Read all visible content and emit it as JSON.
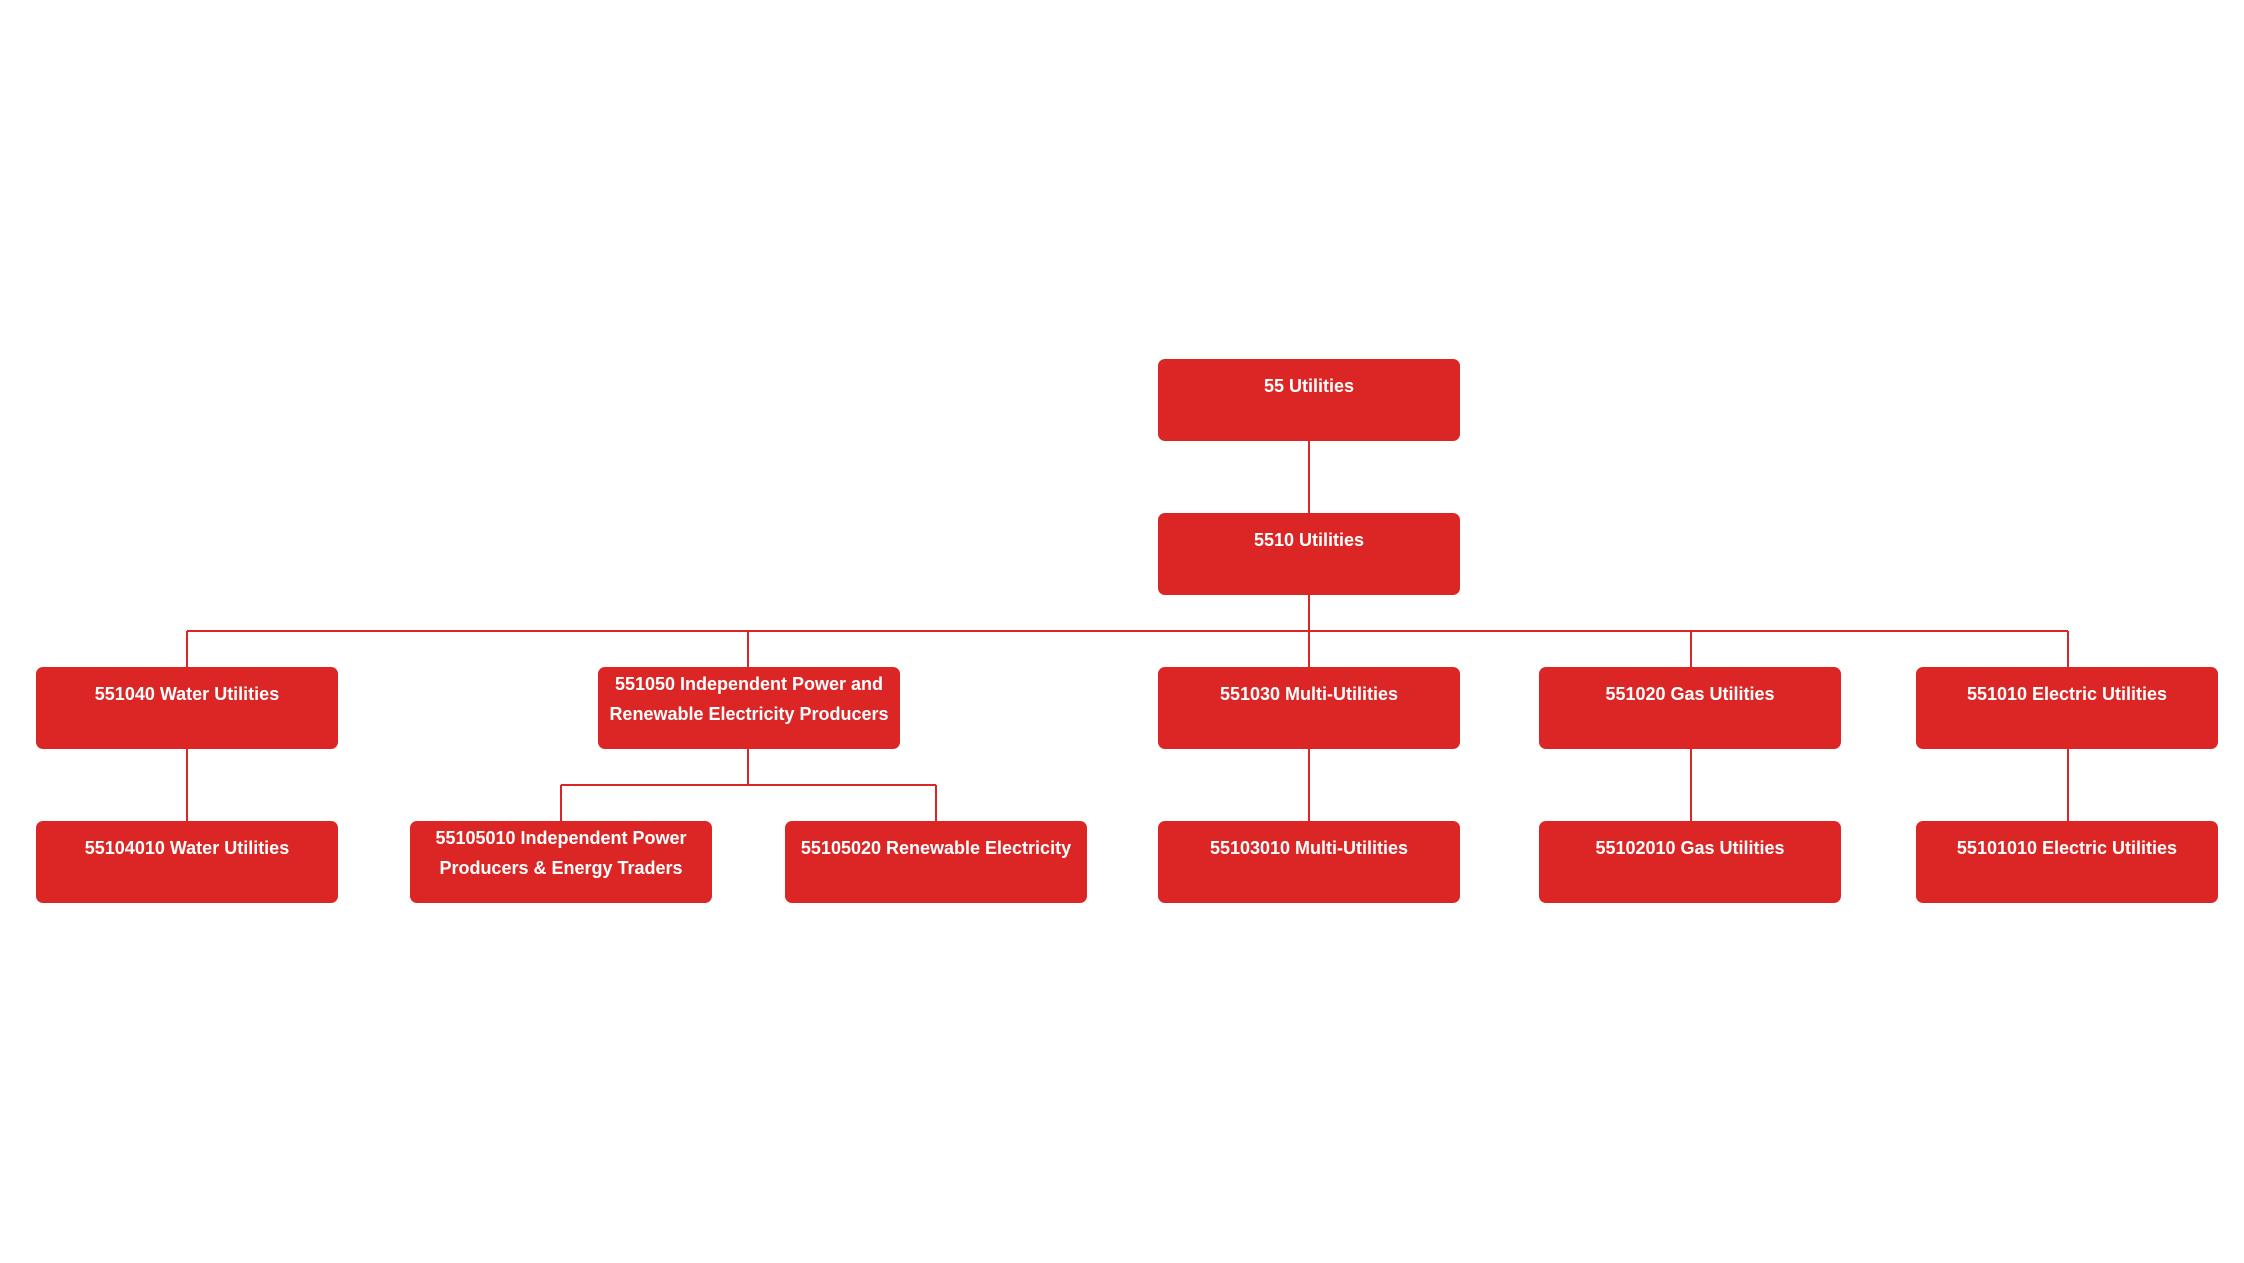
{
  "colors": {
    "node": "#dc2626",
    "line": "#dc2626",
    "text": "#ffffff"
  },
  "nodes": {
    "root": "55 Utilities",
    "group": "5510 Utilities",
    "water": "551040 Water Utilities",
    "ipp": "551050 Independent Power and Renewable Electricity Producers",
    "multi": "551030 Multi-Utilities",
    "gas": "551020 Gas Utilities",
    "electric": "551010 Electric Utilities",
    "water_sub": "55104010 Water Utilities",
    "ipp_sub1": "55105010 Independent Power Producers & Energy Traders",
    "ipp_sub2": "55105020 Renewable Electricity",
    "multi_sub": "55103010 Multi-Utilities",
    "gas_sub": "55102010 Gas Utilities",
    "electric_sub": "55101010 Electric Utilities"
  }
}
